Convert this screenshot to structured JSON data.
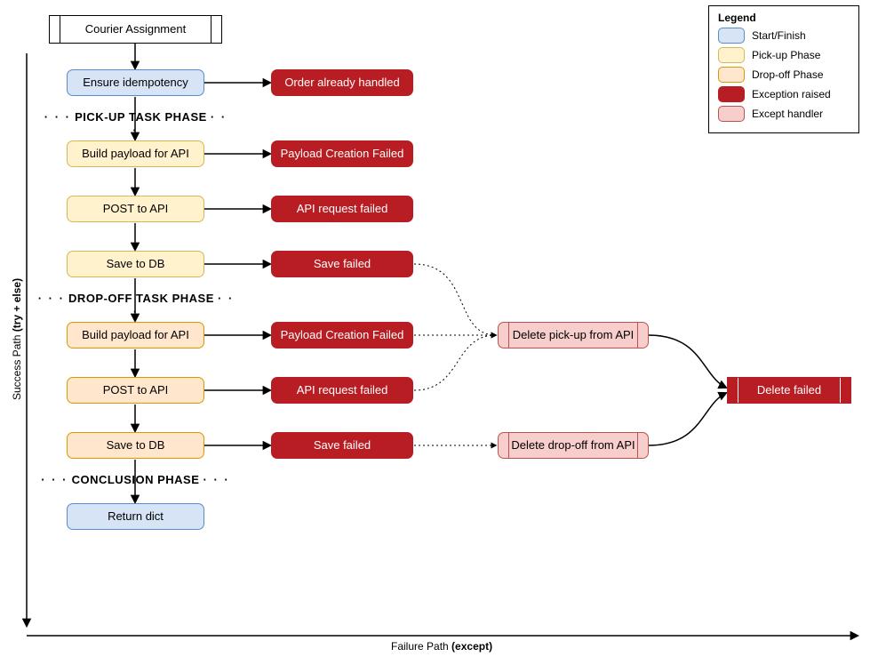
{
  "title_node": "Courier Assignment",
  "start_node": "Ensure idempotency",
  "phase_pickup": "PICK-UP TASK PHASE",
  "phase_dropoff": "DROP-OFF TASK PHASE",
  "phase_conclusion": "CONCLUSION PHASE",
  "steps": {
    "pickup": {
      "build": "Build payload for API",
      "post": "POST to API",
      "save": "Save to DB"
    },
    "dropoff": {
      "build": "Build payload for API",
      "post": "POST to API",
      "save": "Save to DB"
    }
  },
  "conclusion_node": "Return dict",
  "errors": {
    "already_handled": "Order already handled",
    "payload_failed": "Payload Creation Failed",
    "api_failed": "API request failed",
    "save_failed": "Save failed",
    "delete_failed": "Delete failed"
  },
  "handlers": {
    "delete_pickup": "Delete pick-up from API",
    "delete_dropoff": "Delete drop-off from API"
  },
  "axes": {
    "y_prefix": "Success Path ",
    "y_bold": "(try + else)",
    "x_prefix": "Failure Path ",
    "x_bold": "(except)"
  },
  "legend": {
    "title": "Legend",
    "items": [
      {
        "label": "Start/Finish",
        "fill": "#d6e4f5",
        "stroke": "#5b8bc9"
      },
      {
        "label": "Pick-up Phase",
        "fill": "#fff2cc",
        "stroke": "#d6b656"
      },
      {
        "label": "Drop-off Phase",
        "fill": "#ffe6cc",
        "stroke": "#d79b00"
      },
      {
        "label": "Exception raised",
        "fill": "#b71d22",
        "stroke": "#b71d22"
      },
      {
        "label": "Except handler",
        "fill": "#f8cecc",
        "stroke": "#b85450"
      }
    ]
  },
  "dots": "· · ·"
}
